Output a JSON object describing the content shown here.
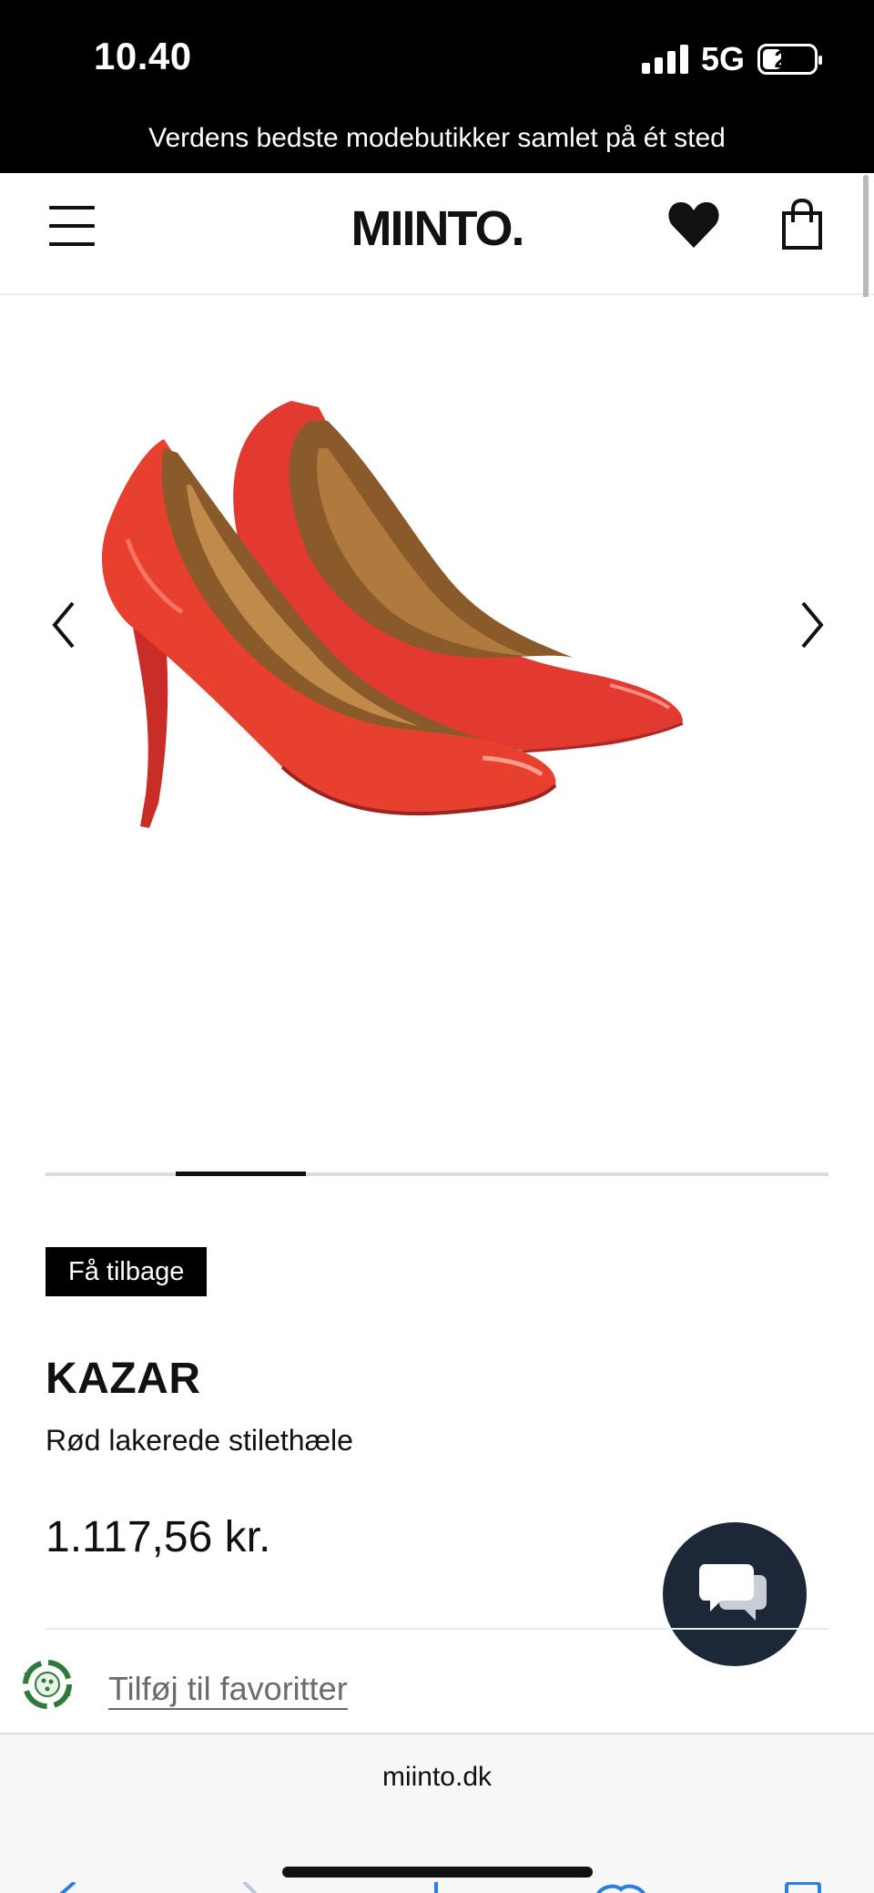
{
  "status_bar": {
    "time": "10.40",
    "network": "5G",
    "battery": "27"
  },
  "promo": {
    "text": "Verdens bedste modebutikker samlet på ét sted"
  },
  "header": {
    "logo": "MIINTO."
  },
  "gallery": {
    "image_description_icon": "red-patent-stiletto-pumps-image",
    "slide_progress": 0.25
  },
  "product": {
    "badge": "Få tilbage",
    "brand": "KAZAR",
    "name": "Rød lakerede stilethæle",
    "price": "1.117,56 kr."
  },
  "actions": {
    "add_to_favorites": "Tilføj til favoritter"
  },
  "browser": {
    "url": "miinto.dk"
  },
  "colors": {
    "chat_button": "#1c2838",
    "shoe_red": "#e53a2f",
    "eco_green": "#2f7a3a"
  }
}
